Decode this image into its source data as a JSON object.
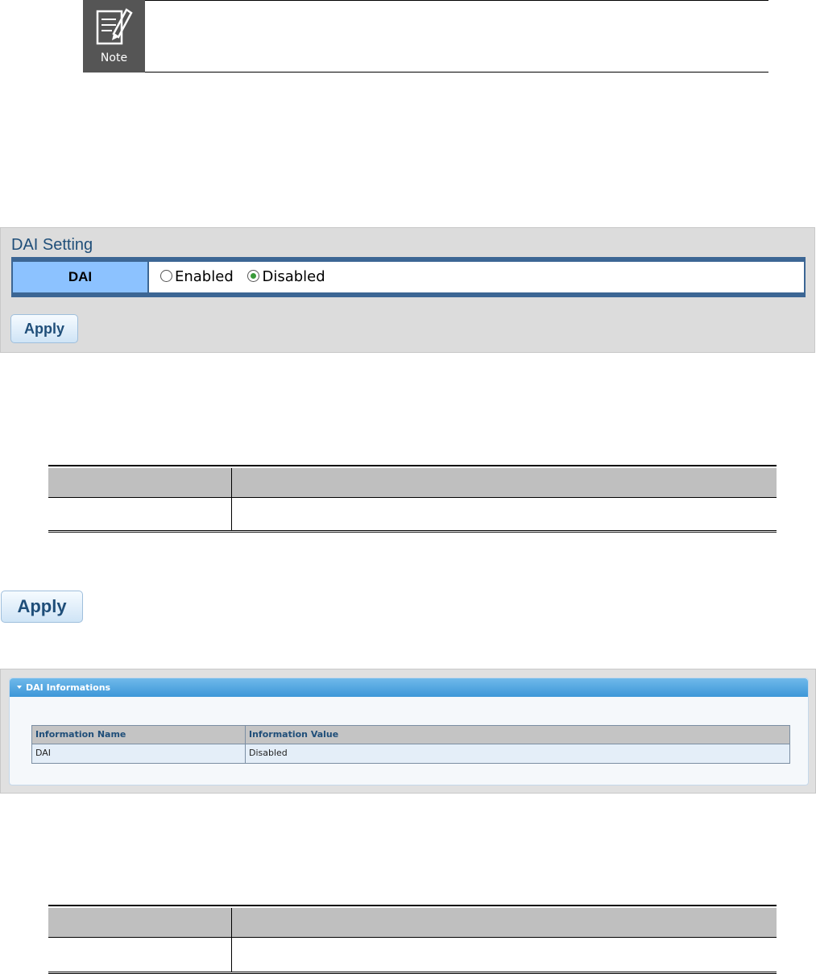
{
  "note": {
    "icon_label": "Note",
    "icon": "note-pencil-icon"
  },
  "dai_setting": {
    "title": "DAI Setting",
    "field_label": "DAI",
    "options": [
      {
        "label": "Enabled",
        "checked": false
      },
      {
        "label": "Disabled",
        "checked": true
      }
    ],
    "apply_label": "Apply"
  },
  "apply_button_large": {
    "label": "Apply"
  },
  "dai_informations": {
    "title": "DAI Informations",
    "columns": [
      "Information Name",
      "Information Value"
    ],
    "rows": [
      {
        "name": "DAI",
        "value": "Disabled"
      }
    ]
  },
  "colors": {
    "panel_bg": "#dcdcdc",
    "label_cell": "#8cc2ff",
    "table_border": "#3c6694",
    "info_header": "#3d97d8"
  }
}
